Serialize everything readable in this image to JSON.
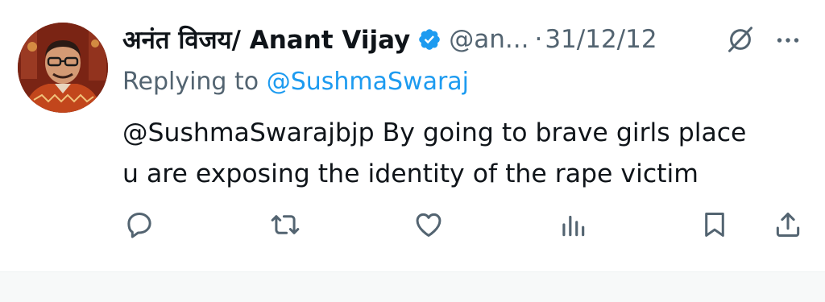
{
  "tweet": {
    "display_name": "अनंत विजय/ Anant Vijay",
    "handle": "@an...",
    "separator": "·",
    "date": "31/12/12",
    "reply_prefix": "Replying to",
    "reply_to": "@SushmaSwaraj",
    "text_lines": [
      "@SushmaSwarajbjp By going to brave girls place",
      "u are exposing the identity of the rape victim"
    ]
  },
  "icons": {
    "verified": "verified-badge-icon",
    "grok": "grok-icon",
    "more": "more-icon",
    "reply": "reply-icon",
    "retweet": "retweet-icon",
    "like": "like-icon",
    "views": "views-icon",
    "bookmark": "bookmark-icon",
    "share": "share-icon"
  },
  "colors": {
    "text": "#0f1419",
    "secondary": "#536471",
    "link": "#1d9bf0",
    "background": "#ffffff"
  }
}
